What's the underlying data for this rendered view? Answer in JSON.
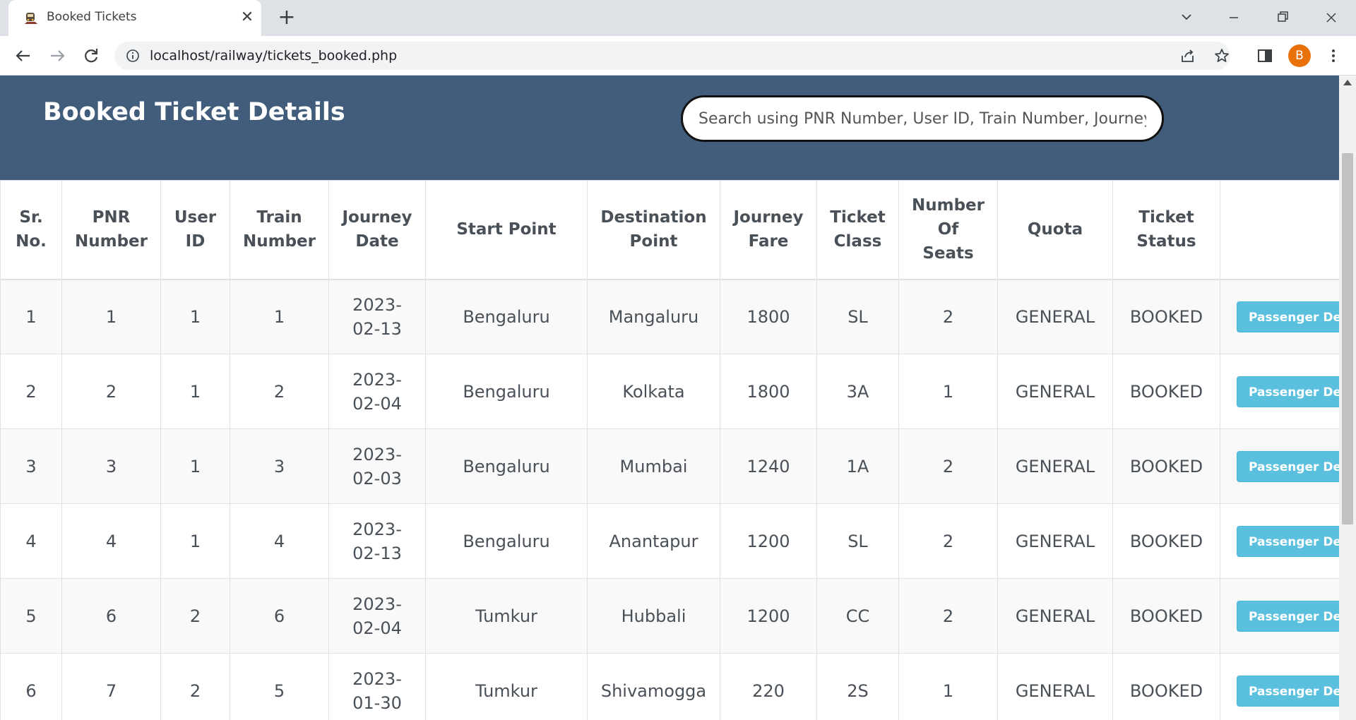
{
  "browser": {
    "tab_title": "Booked Tickets",
    "url": "localhost/railway/tickets_booked.php",
    "profile_initial": "B"
  },
  "page": {
    "title": "Booked Ticket Details",
    "search_placeholder": "Search using PNR Number, User ID, Train Number, Journey D"
  },
  "table": {
    "headers": [
      [
        "Sr.",
        "No."
      ],
      [
        "PNR",
        "Number"
      ],
      [
        "User",
        "ID"
      ],
      [
        "Train",
        "Number"
      ],
      [
        "Journey",
        "Date"
      ],
      [
        "Start Point"
      ],
      [
        "Destination",
        "Point"
      ],
      [
        "Journey",
        "Fare"
      ],
      [
        "Ticket",
        "Class"
      ],
      [
        "Number",
        "Of",
        "Seats"
      ],
      [
        "Quota"
      ],
      [
        "Ticket",
        "Status"
      ],
      []
    ],
    "action_label": "Passenger Details",
    "rows": [
      {
        "sr": "1",
        "pnr": "1",
        "user": "1",
        "train": "1",
        "date_a": "2023-",
        "date_b": "02-13",
        "start": "Bengaluru",
        "dest": "Mangaluru",
        "fare": "1800",
        "class": "SL",
        "seats": "2",
        "quota": "GENERAL",
        "status": "BOOKED"
      },
      {
        "sr": "2",
        "pnr": "2",
        "user": "1",
        "train": "2",
        "date_a": "2023-",
        "date_b": "02-04",
        "start": "Bengaluru",
        "dest": "Kolkata",
        "fare": "1800",
        "class": "3A",
        "seats": "1",
        "quota": "GENERAL",
        "status": "BOOKED"
      },
      {
        "sr": "3",
        "pnr": "3",
        "user": "1",
        "train": "3",
        "date_a": "2023-",
        "date_b": "02-03",
        "start": "Bengaluru",
        "dest": "Mumbai",
        "fare": "1240",
        "class": "1A",
        "seats": "2",
        "quota": "GENERAL",
        "status": "BOOKED"
      },
      {
        "sr": "4",
        "pnr": "4",
        "user": "1",
        "train": "4",
        "date_a": "2023-",
        "date_b": "02-13",
        "start": "Bengaluru",
        "dest": "Anantapur",
        "fare": "1200",
        "class": "SL",
        "seats": "2",
        "quota": "GENERAL",
        "status": "BOOKED"
      },
      {
        "sr": "5",
        "pnr": "6",
        "user": "2",
        "train": "6",
        "date_a": "2023-",
        "date_b": "02-04",
        "start": "Tumkur",
        "dest": "Hubbali",
        "fare": "1200",
        "class": "CC",
        "seats": "2",
        "quota": "GENERAL",
        "status": "BOOKED"
      },
      {
        "sr": "6",
        "pnr": "7",
        "user": "2",
        "train": "5",
        "date_a": "2023-",
        "date_b": "01-30",
        "start": "Tumkur",
        "dest": "Shivamogga",
        "fare": "220",
        "class": "2S",
        "seats": "1",
        "quota": "GENERAL",
        "status": "BOOKED"
      }
    ]
  },
  "icons": {
    "favicon": "train-favicon",
    "back": "arrow-left-icon",
    "forward": "arrow-right-icon",
    "reload": "reload-icon",
    "info": "info-icon",
    "share": "share-icon",
    "bookmark": "star-icon",
    "side_panel": "side-panel-icon",
    "menu": "kebab-menu-icon"
  },
  "colors": {
    "header_band": "#415d7b",
    "action_button": "#5bc0de",
    "avatar": "#e8710a"
  }
}
